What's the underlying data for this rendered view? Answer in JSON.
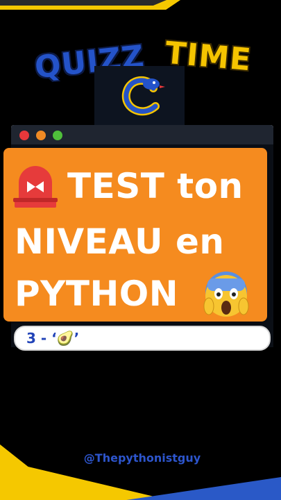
{
  "header": {
    "title_word_1": "QUIZZ",
    "title_word_2": "TIME"
  },
  "window": {
    "controls": [
      "close",
      "minimize",
      "maximize"
    ],
    "options": [
      {
        "label": "3 - ‘🥑’"
      }
    ]
  },
  "banner": {
    "line_1": "TEST ton",
    "line_2": "NIVEAU en",
    "line_3": "PYTHON",
    "alarm_icon": "rotating-light",
    "face_icon": "screaming-face"
  },
  "footer": {
    "handle": "@Thepythonistguy"
  },
  "colors": {
    "banner": "#f58b1f",
    "accent_blue": "#2453c9",
    "accent_yellow": "#f5c400"
  }
}
